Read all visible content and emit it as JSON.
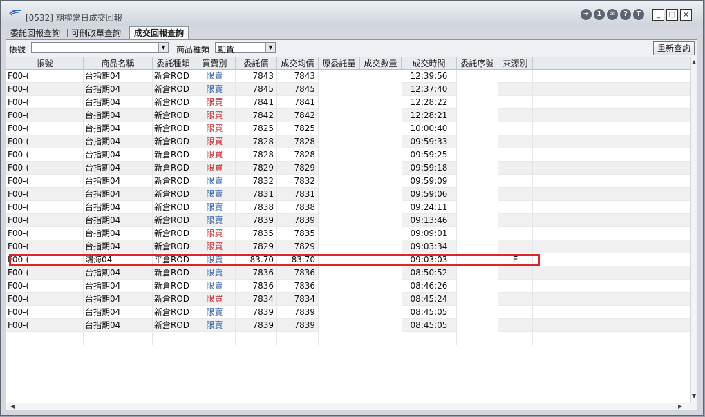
{
  "window": {
    "title": "[0532] 期權當日成交回報",
    "buttons": [
      "➜",
      "1",
      "✉",
      "?",
      "T",
      "_",
      "□",
      "×"
    ]
  },
  "tabs": [
    {
      "label": "委託回報查詢",
      "active": false
    },
    {
      "label": "可刪改單查詢",
      "active": false
    },
    {
      "label": "成交回報查詢",
      "active": true
    }
  ],
  "toolbar": {
    "account_label": "帳號",
    "account_value": "",
    "product_type_label": "商品種類",
    "product_type_value": "期貨",
    "refresh_label": "重新查詢"
  },
  "table": {
    "columns": [
      "帳號",
      "商品名稱",
      "委託種類",
      "買賣別",
      "委託價",
      "成交均價",
      "原委託量",
      "成交數量",
      "成交時間",
      "委託序號",
      "來源別"
    ],
    "rows": [
      {
        "account": "F00-(",
        "product": "台指期04",
        "order_type": "新倉ROD",
        "side": "限賣",
        "price": "7843",
        "avg": "7843",
        "time": "12:39:56",
        "source": ""
      },
      {
        "account": "F00-(",
        "product": "台指期04",
        "order_type": "新倉ROD",
        "side": "限賣",
        "price": "7845",
        "avg": "7845",
        "time": "12:37:40",
        "source": ""
      },
      {
        "account": "F00-(",
        "product": "台指期04",
        "order_type": "新倉ROD",
        "side": "限買",
        "price": "7841",
        "avg": "7841",
        "time": "12:28:22",
        "source": ""
      },
      {
        "account": "F00-(",
        "product": "台指期04",
        "order_type": "新倉ROD",
        "side": "限買",
        "price": "7842",
        "avg": "7842",
        "time": "12:28:21",
        "source": ""
      },
      {
        "account": "F00-(",
        "product": "台指期04",
        "order_type": "新倉ROD",
        "side": "限買",
        "price": "7825",
        "avg": "7825",
        "time": "10:00:40",
        "source": ""
      },
      {
        "account": "F00-(",
        "product": "台指期04",
        "order_type": "新倉ROD",
        "side": "限買",
        "price": "7828",
        "avg": "7828",
        "time": "09:59:33",
        "source": ""
      },
      {
        "account": "F00-(",
        "product": "台指期04",
        "order_type": "新倉ROD",
        "side": "限買",
        "price": "7828",
        "avg": "7828",
        "time": "09:59:25",
        "source": ""
      },
      {
        "account": "F00-(",
        "product": "台指期04",
        "order_type": "新倉ROD",
        "side": "限買",
        "price": "7829",
        "avg": "7829",
        "time": "09:59:18",
        "source": ""
      },
      {
        "account": "F00-(",
        "product": "台指期04",
        "order_type": "新倉ROD",
        "side": "限賣",
        "price": "7832",
        "avg": "7832",
        "time": "09:59:09",
        "source": ""
      },
      {
        "account": "F00-(",
        "product": "台指期04",
        "order_type": "新倉ROD",
        "side": "限賣",
        "price": "7831",
        "avg": "7831",
        "time": "09:59:06",
        "source": ""
      },
      {
        "account": "F00-(",
        "product": "台指期04",
        "order_type": "新倉ROD",
        "side": "限賣",
        "price": "7838",
        "avg": "7838",
        "time": "09:24:11",
        "source": ""
      },
      {
        "account": "F00-(",
        "product": "台指期04",
        "order_type": "新倉ROD",
        "side": "限賣",
        "price": "7839",
        "avg": "7839",
        "time": "09:13:46",
        "source": ""
      },
      {
        "account": "F00-(",
        "product": "台指期04",
        "order_type": "新倉ROD",
        "side": "限買",
        "price": "7835",
        "avg": "7835",
        "time": "09:09:01",
        "source": ""
      },
      {
        "account": "F00-(",
        "product": "台指期04",
        "order_type": "新倉ROD",
        "side": "限買",
        "price": "7829",
        "avg": "7829",
        "time": "09:03:34",
        "source": ""
      },
      {
        "account": "F00-(",
        "product": "鴻海04",
        "order_type": "平倉ROD",
        "side": "限賣",
        "price": "83.70",
        "avg": "83.70",
        "time": "09:03:03",
        "source": "E"
      },
      {
        "account": "F00-(",
        "product": "台指期04",
        "order_type": "新倉ROD",
        "side": "限賣",
        "price": "7836",
        "avg": "7836",
        "time": "08:50:52",
        "source": ""
      },
      {
        "account": "F00-(",
        "product": "台指期04",
        "order_type": "新倉ROD",
        "side": "限賣",
        "price": "7836",
        "avg": "7836",
        "time": "08:46:26",
        "source": ""
      },
      {
        "account": "F00-(",
        "product": "台指期04",
        "order_type": "新倉ROD",
        "side": "限買",
        "price": "7834",
        "avg": "7834",
        "time": "08:45:24",
        "source": ""
      },
      {
        "account": "F00-(",
        "product": "台指期04",
        "order_type": "新倉ROD",
        "side": "限賣",
        "price": "7839",
        "avg": "7839",
        "time": "08:45:05",
        "source": ""
      },
      {
        "account": "F00-(",
        "product": "台指期04",
        "order_type": "新倉ROD",
        "side": "限賣",
        "price": "7839",
        "avg": "7839",
        "time": "08:45:05",
        "source": ""
      }
    ]
  },
  "colors": {
    "sell": "#2e5fae",
    "buy": "#c8262a",
    "highlight_border": "#e0242a"
  }
}
